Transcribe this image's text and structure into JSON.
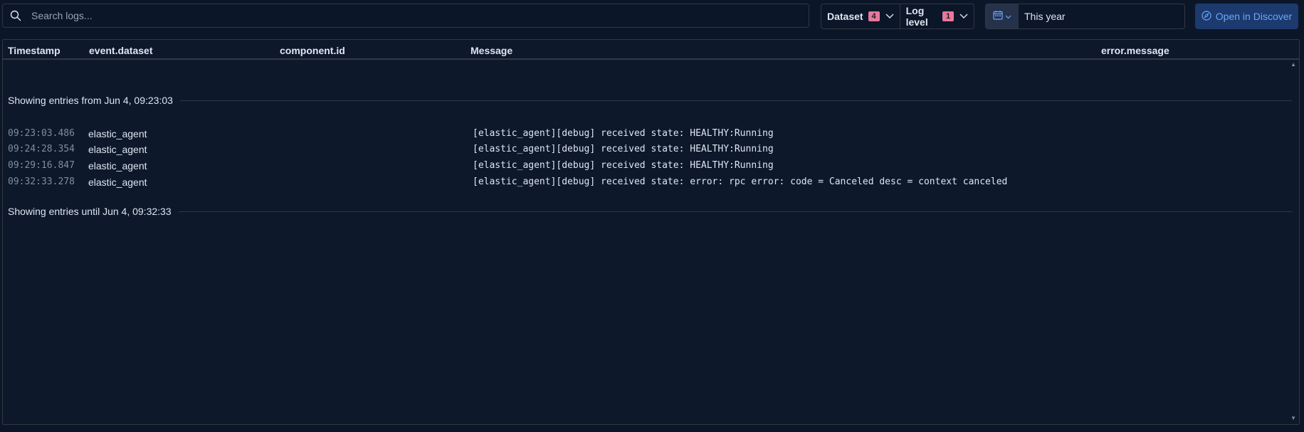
{
  "search": {
    "placeholder": "Search logs..."
  },
  "filters": [
    {
      "label": "Dataset",
      "count": "4"
    },
    {
      "label": "Log level",
      "count": "1"
    }
  ],
  "date_picker": {
    "value": "This year"
  },
  "open_discover": {
    "label": "Open in Discover"
  },
  "columns": [
    "Timestamp",
    "event.dataset",
    "component.id",
    "Message",
    "error.message"
  ],
  "divider_start": "Showing entries from Jun 4, 09:23:03",
  "divider_end": "Showing entries until Jun 4, 09:32:33",
  "rows": [
    {
      "timestamp": "09:23:03.486",
      "dataset": "elastic_agent",
      "message": "[elastic_agent][debug] received state: HEALTHY:Running"
    },
    {
      "timestamp": "09:24:28.354",
      "dataset": "elastic_agent",
      "message": "[elastic_agent][debug] received state: HEALTHY:Running"
    },
    {
      "timestamp": "09:29:16.847",
      "dataset": "elastic_agent",
      "message": "[elastic_agent][debug] received state: HEALTHY:Running"
    },
    {
      "timestamp": "09:32:33.278",
      "dataset": "elastic_agent",
      "message": "[elastic_agent][debug] received state: error: rpc error: code = Canceled desc = context canceled"
    }
  ],
  "colors": {
    "background": "#0b1628",
    "border": "#343741",
    "badge": "#e8789c",
    "accent": "#6aa7ff",
    "timestamp": "#7f8ca4"
  },
  "icons": [
    "search-icon",
    "chevron-down-icon",
    "calendar-icon",
    "compass-icon"
  ]
}
